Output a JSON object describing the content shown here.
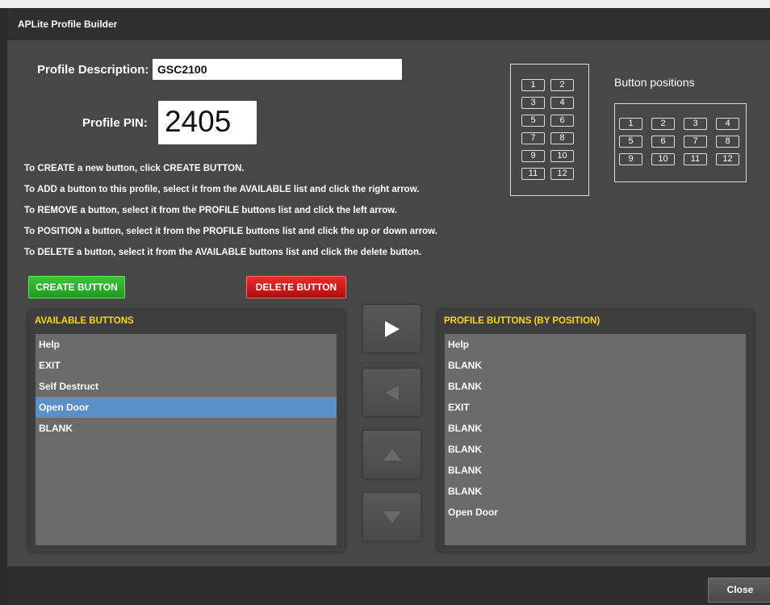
{
  "window": {
    "title": "APLite Profile Builder"
  },
  "profile": {
    "description_label": "Profile Description:",
    "description_value": "GSC2100",
    "pin_label": "Profile PIN:",
    "pin_value": "2405"
  },
  "instructions": [
    "To CREATE a new button, click CREATE BUTTON.",
    "To ADD a button to this profile, select it from the AVAILABLE list and click the right arrow.",
    "To REMOVE a button, select it from the PROFILE buttons list and click the left arrow.",
    "To POSITION a button, select it from the PROFILE buttons list and click the up or down arrow.",
    "To DELETE a button, select it from the AVAILABLE buttons list and click the delete button."
  ],
  "positions": {
    "title": "Button positions",
    "vertical_numbers": [
      "1",
      "2",
      "3",
      "4",
      "5",
      "6",
      "7",
      "8",
      "9",
      "10",
      "11",
      "12"
    ],
    "horizontal_numbers": [
      "1",
      "2",
      "3",
      "4",
      "5",
      "6",
      "7",
      "8",
      "9",
      "10",
      "11",
      "12"
    ]
  },
  "actions": {
    "create_label": "CREATE BUTTON",
    "delete_label": "DELETE BUTTON",
    "close_label": "Close"
  },
  "available": {
    "header": "AVAILABLE BUTTONS",
    "items": [
      "Help",
      "EXIT",
      "Self Destruct",
      "Open Door",
      "BLANK"
    ],
    "selected": "Open Door"
  },
  "profile_buttons": {
    "header": "PROFILE BUTTONS (BY POSITION)",
    "items": [
      "Help",
      "BLANK",
      "BLANK",
      "EXIT",
      "BLANK",
      "BLANK",
      "BLANK",
      "BLANK",
      "Open Door"
    ]
  },
  "arrows": {
    "right_icon": "arrow-right-icon",
    "left_icon": "arrow-left-icon",
    "up_icon": "arrow-up-icon",
    "down_icon": "arrow-down-icon"
  }
}
